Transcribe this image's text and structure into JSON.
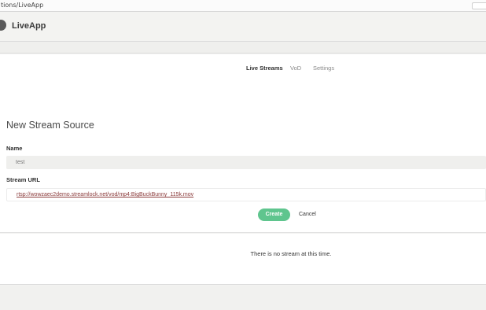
{
  "browser": {
    "address_text": "tions/LiveApp"
  },
  "header": {
    "app_name": "LiveApp"
  },
  "nav": {
    "tabs": [
      {
        "label": "Live Streams"
      },
      {
        "label": "VoD"
      },
      {
        "label": "Settings"
      }
    ]
  },
  "form": {
    "title": "New Stream Source",
    "name_label": "Name",
    "name_value": "test",
    "url_label": "Stream URL",
    "url_value": "rtsp://wowzaec2demo.streamlock.net/vod/mp4:BigBuckBunny_115k.mov",
    "create_label": "Create",
    "cancel_label": "Cancel"
  },
  "streams": {
    "empty_message": "There is no stream at this time."
  },
  "colors": {
    "accent": "#5fc58e",
    "background": "#f3f3f1"
  }
}
